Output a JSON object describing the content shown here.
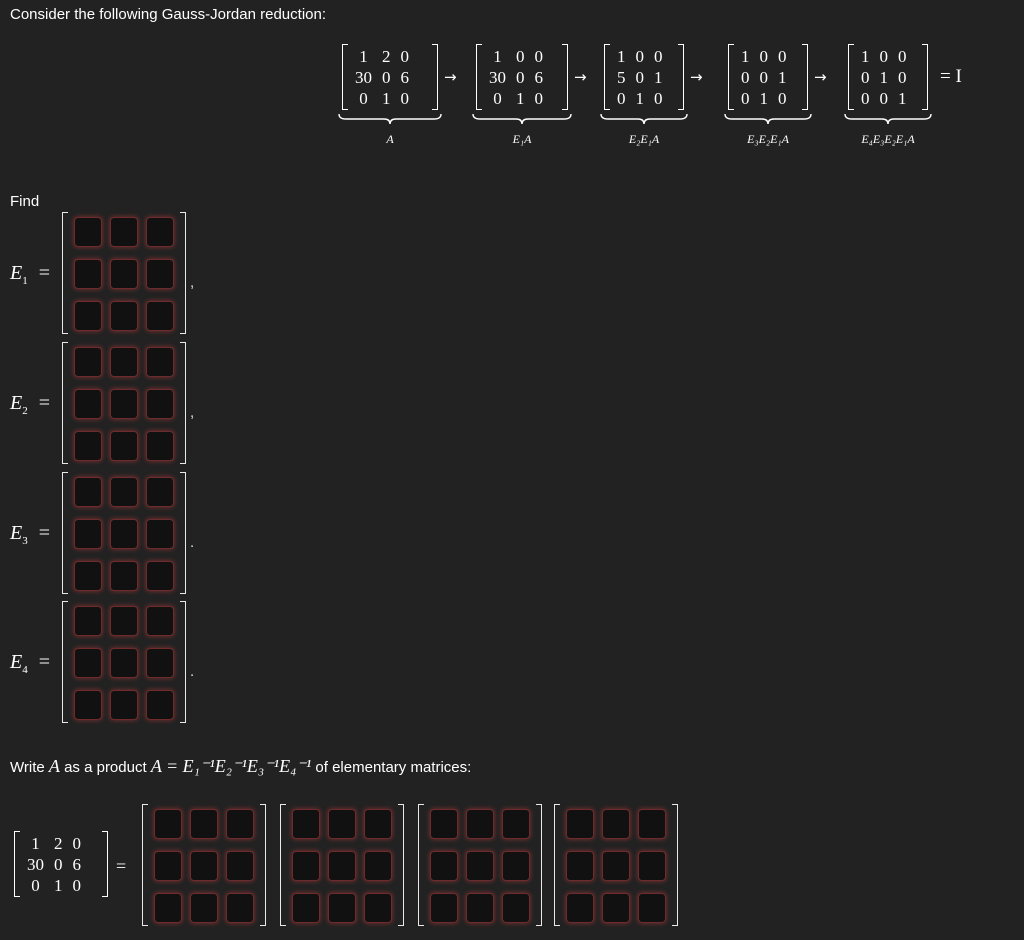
{
  "intro_text": "Consider the following Gauss-Jordan reduction:",
  "reduction": {
    "matrices": [
      [
        [
          "1",
          "2",
          "0"
        ],
        [
          "30",
          "0",
          "6"
        ],
        [
          "0",
          "1",
          "0"
        ]
      ],
      [
        [
          "1",
          "0",
          "0"
        ],
        [
          "30",
          "0",
          "6"
        ],
        [
          "0",
          "1",
          "0"
        ]
      ],
      [
        [
          "1",
          "0",
          "0"
        ],
        [
          "5",
          "0",
          "1"
        ],
        [
          "0",
          "1",
          "0"
        ]
      ],
      [
        [
          "1",
          "0",
          "0"
        ],
        [
          "0",
          "0",
          "1"
        ],
        [
          "0",
          "1",
          "0"
        ]
      ],
      [
        [
          "1",
          "0",
          "0"
        ],
        [
          "0",
          "1",
          "0"
        ],
        [
          "0",
          "0",
          "1"
        ]
      ]
    ],
    "labels": [
      "A",
      "E₁A",
      "E₂E₁A",
      "E₃E₂E₁A",
      "E₄E₃E₂E₁A"
    ],
    "arrow": "→",
    "final": "= I"
  },
  "find_text": "Find",
  "elementary": [
    {
      "name": "E",
      "sub": "1",
      "eq": "=",
      "punct": ","
    },
    {
      "name": "E",
      "sub": "2",
      "eq": "=",
      "punct": ","
    },
    {
      "name": "E",
      "sub": "3",
      "eq": "=",
      "punct": "."
    },
    {
      "name": "E",
      "sub": "4",
      "eq": "=",
      "punct": "."
    }
  ],
  "write_text": {
    "before": "Write",
    "var": "A",
    "middle": "as a product",
    "formula": "A = E₁⁻¹E₂⁻¹E₃⁻¹E₄⁻¹",
    "after": "of elementary matrices:"
  },
  "product_lhs": [
    [
      "1",
      "2",
      "0"
    ],
    [
      "30",
      "0",
      "6"
    ],
    [
      "0",
      "1",
      "0"
    ]
  ],
  "product_eq": "=",
  "colors": {
    "background": "#222222",
    "text": "#ffffff",
    "cell_border": "#6f2b2b",
    "cell_bg": "#111111"
  }
}
